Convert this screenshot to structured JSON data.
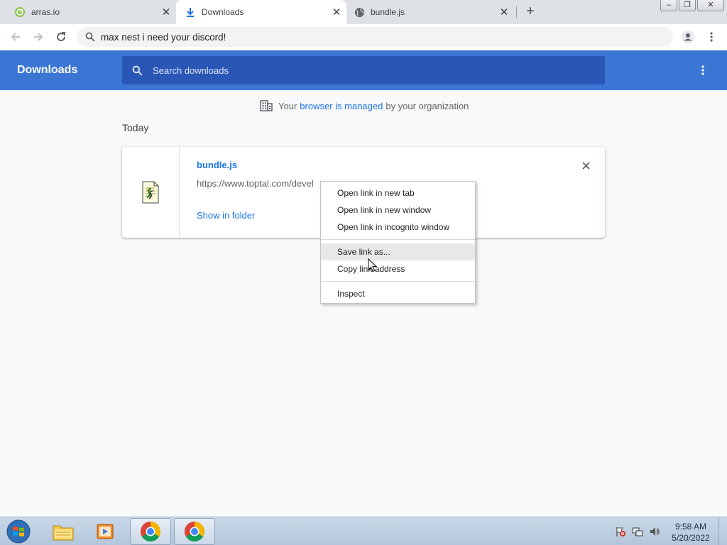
{
  "tabs": [
    {
      "title": "arras.io",
      "icon": "arras-favicon",
      "active": false
    },
    {
      "title": "Downloads",
      "icon": "download-icon",
      "active": true
    },
    {
      "title": "bundle.js",
      "icon": "globe-icon",
      "active": false
    }
  ],
  "omnibox": {
    "text": "max nest i need your discord!"
  },
  "downloads": {
    "title": "Downloads",
    "search_placeholder": "Search downloads",
    "managed": {
      "before": "Your",
      "link": "browser is managed",
      "after": "by your organization"
    },
    "date_header": "Today",
    "item": {
      "name": "bundle.js",
      "url": "https://www.toptal.com/devel",
      "show_in_folder": "Show in folder"
    }
  },
  "context_menu": {
    "items": [
      {
        "label": "Open link in new tab"
      },
      {
        "label": "Open link in new window"
      },
      {
        "label": "Open link in incognito window"
      },
      {
        "label": "Save link as..."
      },
      {
        "label": "Copy link address"
      },
      {
        "label": "Inspect"
      }
    ],
    "hovered": "Save link as..."
  },
  "taskbar": {
    "clock_time": "9:58 AM",
    "clock_date": "5/20/2022"
  },
  "colors": {
    "header_blue": "#3b76d5",
    "search_blue": "#2a56b5",
    "link_blue": "#1a73e8"
  }
}
